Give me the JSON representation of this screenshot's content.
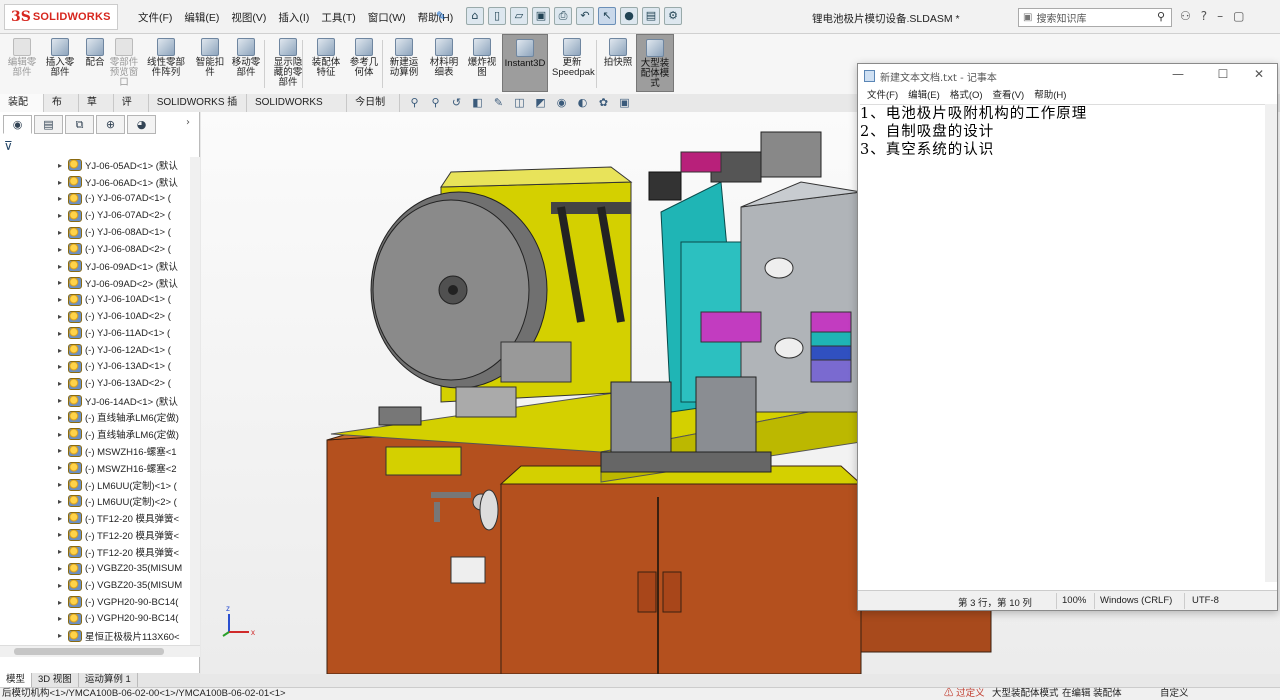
{
  "app": {
    "logo_mark": "3S",
    "logo_text": "SOLIDWORKS",
    "menu": [
      "文件(F)",
      "编辑(E)",
      "视图(V)",
      "插入(I)",
      "工具(T)",
      "窗口(W)",
      "帮助(H)"
    ],
    "document_title": "锂电池极片模切设备.SLDASM *",
    "search_placeholder": "搜索知识库"
  },
  "command_manager": [
    {
      "label": "编辑零\n部件",
      "disabled": true
    },
    {
      "label": "插入零\n部件",
      "disabled": false
    },
    {
      "label": "配合",
      "disabled": false
    },
    {
      "label": "零部件\n预览窗\n口",
      "disabled": true
    },
    {
      "label": "线性零部\n件阵列",
      "disabled": false
    },
    {
      "label": "智能扣\n件",
      "disabled": false
    },
    {
      "label": "移动零\n部件",
      "disabled": false
    },
    {
      "label": "显示隐\n藏的零\n部件",
      "disabled": false
    },
    {
      "label": "装配体\n特征",
      "disabled": false
    },
    {
      "label": "参考几\n何体",
      "disabled": false
    },
    {
      "label": "新建运\n动算例",
      "disabled": false
    },
    {
      "label": "材料明\n细表",
      "disabled": false
    },
    {
      "label": "爆炸视\n图",
      "disabled": false
    },
    {
      "label": "Instant3D",
      "disabled": false
    },
    {
      "label": "更新\nSpeedpak",
      "disabled": false
    },
    {
      "label": "拍快照",
      "disabled": false
    },
    {
      "label": "大型装\n配体模\n式",
      "disabled": false
    }
  ],
  "tabs": [
    "装配体",
    "布局",
    "草图",
    "评估",
    "SOLIDWORKS 插件",
    "SOLIDWORKS MBD",
    "今日制造"
  ],
  "feature_tree": {
    "items": [
      "YJ-06-05AD<1> (默认",
      "YJ-06-06AD<1> (默认",
      "(-) YJ-06-07AD<1> (",
      "(-) YJ-06-07AD<2> (",
      "(-) YJ-06-08AD<1> (",
      "(-) YJ-06-08AD<2> (",
      "YJ-06-09AD<1> (默认",
      "YJ-06-09AD<2> (默认",
      "(-) YJ-06-10AD<1> (",
      "(-) YJ-06-10AD<2> (",
      "(-) YJ-06-11AD<1> (",
      "(-) YJ-06-12AD<1> (",
      "(-) YJ-06-13AD<1> (",
      "(-) YJ-06-13AD<2> (",
      "YJ-06-14AD<1> (默认",
      "(-) 直线轴承LM6(定做)",
      "(-) 直线轴承LM6(定做)",
      "(-) MSWZH16-螺塞<1",
      "(-) MSWZH16-螺塞<2",
      "(-) LM6UU(定制)<1> (",
      "(-) LM6UU(定制)<2> (",
      "(-) TF12-20 模具弹簧<",
      "(-) TF12-20 模具弹簧<",
      "(-) TF12-20 模具弹簧<",
      "(-) VGBZ20-35(MISUM",
      "(-) VGBZ20-35(MISUM",
      "(-) VGPH20-90-BC14(",
      "(-) VGPH20-90-BC14(",
      "星恒正极极片113X60<"
    ]
  },
  "bottom_tabs": [
    "模型",
    "3D 视图",
    "运动算例 1"
  ],
  "status_bar": {
    "path": "后模切机构<1>/YMCA100B-06-02-00<1>/YMCA100B-06-02-01<1>",
    "warning": "过定义",
    "mode": "大型装配体模式",
    "edit": "在编辑 装配体",
    "custom": "自定义"
  },
  "notepad": {
    "title": "新建文本文档.txt - 记事本",
    "menu": [
      "文件(F)",
      "编辑(E)",
      "格式(O)",
      "查看(V)",
      "帮助(H)"
    ],
    "lines": [
      "1、电池极片吸附机构的工作原理",
      "2、自制吸盘的设计",
      "3、真空系统的认识"
    ],
    "status": {
      "position": "第 3 行，第 10 列",
      "zoom": "100%",
      "line_ending": "Windows (CRLF)",
      "encoding": "UTF-8"
    }
  },
  "colors": {
    "accent_red": "#d7261e",
    "machine_yellow": "#d4d000",
    "machine_orange": "#b4501e",
    "machine_teal": "#1fb5b5",
    "machine_grey": "#9aa0a6"
  }
}
